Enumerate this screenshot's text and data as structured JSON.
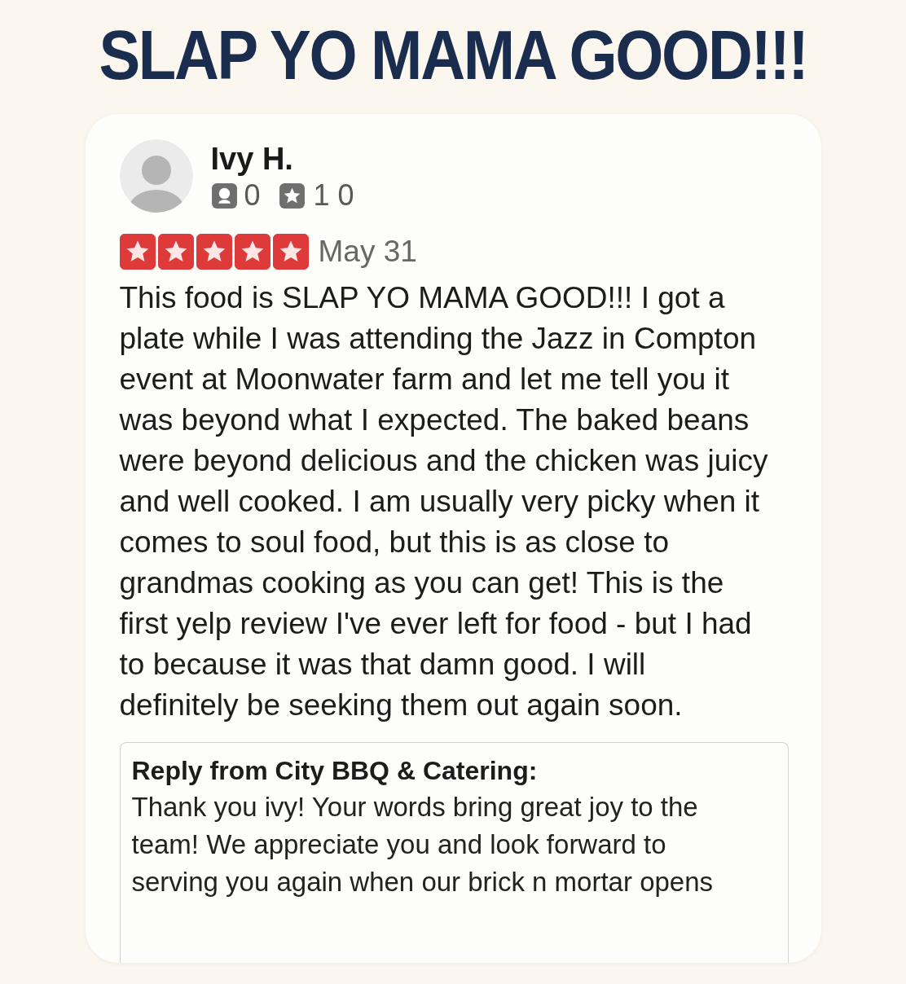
{
  "headline": "SLAP YO MAMA GOOD!!!",
  "review": {
    "reviewer": {
      "name": "Ivy H.",
      "friends": "0",
      "reviews": "1 0"
    },
    "stars": 5,
    "date": "May 31",
    "text": "This food is SLAP YO MAMA GOOD!!! I got a plate while I was attending the Jazz in Compton event at Moonwater farm and let me tell you it was beyond what I expected. The baked beans were beyond delicious and the chicken was juicy and well cooked. I am usually very picky when it comes to soul food, but this is as close to grandmas cooking as you can get! This is the first yelp review I've ever left for food - but I had to because it was that damn good. I will definitely be seeking them out again soon.",
    "reply": {
      "title": "Reply from City BBQ & Catering:",
      "text": "Thank you ivy! Your words bring great joy to the team! We appreciate you and look forward to serving you again when our brick n mortar opens"
    }
  }
}
